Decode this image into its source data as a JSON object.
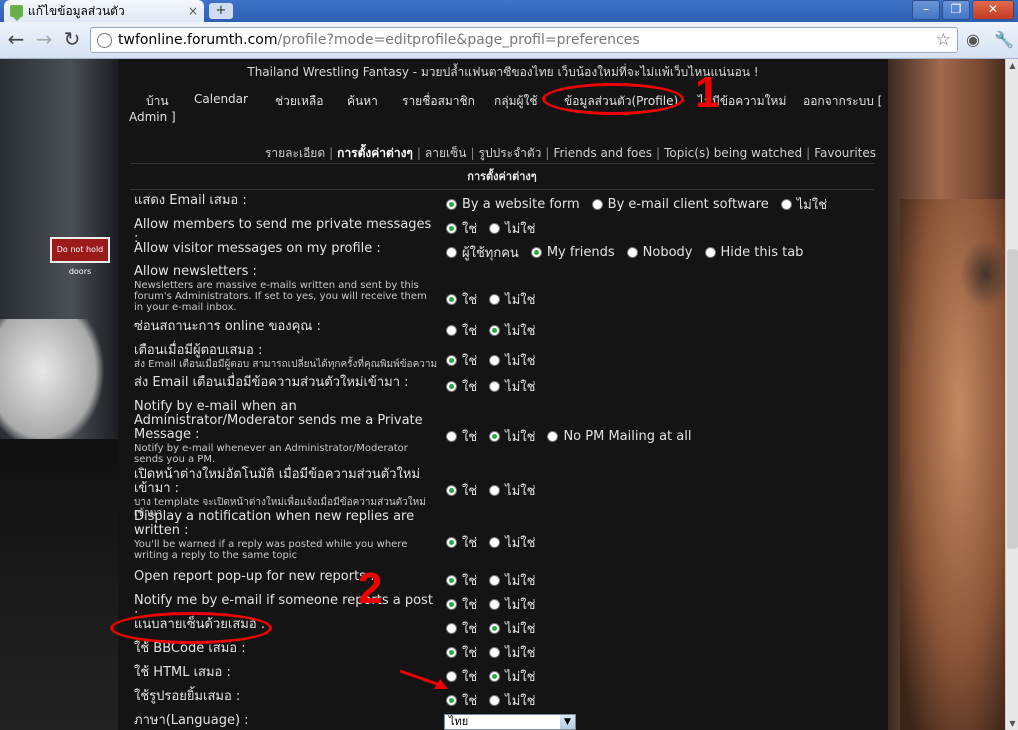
{
  "browser": {
    "tab_title": "แก้ไขข้อมูลส่วนตัว",
    "tab_close": "×",
    "new_tab": "+",
    "window_minimize": "–",
    "window_maximize": "❐",
    "window_close": "✕",
    "back": "←",
    "forward": "→",
    "reload": "↻",
    "url_domain": "twfonline.forumth.com",
    "url_path": "/profile?mode=editprofile&page_profil=preferences",
    "star": "☆"
  },
  "site": {
    "title": "Thailand Wrestling Fantasy - มวยปล้ำแฟนตาซีของไทย เว็บน้องใหม่ที่จะไม่แพ้เว็บไหนแน่นอน !",
    "nav": [
      "บ้าน",
      "Calendar",
      "ช่วยเหลือ",
      "ค้นหา",
      "รายชื่อสมาชิก",
      "กลุ่มผู้ใช้",
      "ข้อมูลส่วนตัว(Profile)",
      "ไม่มีข้อความใหม่",
      "ออกจากระบบ [",
      "Admin ]"
    ],
    "subnav": [
      "รายละเอียด",
      "การตั้งค่าต่างๆ",
      "ลายเซ็น",
      "รูปประจำตัว",
      "Friends and foes",
      "Topic(s) being watched",
      "Favourites"
    ],
    "section_header": "การตั้งค่าต่างๆ",
    "bg_sign": "Do not hold doors"
  },
  "prefs": [
    {
      "label": "แสดง Email เสมอ :",
      "options": [
        "By a website form",
        "By e-mail client software",
        "ไม่ใช่"
      ],
      "selected": 0
    },
    {
      "label": "Allow members to send me private messages :",
      "options": [
        "ใช่",
        "ไม่ใช่"
      ],
      "selected": 0
    },
    {
      "label": "Allow visitor messages on my profile :",
      "options": [
        "ผู้ใช้ทุกคน",
        "My friends",
        "Nobody",
        "Hide this tab"
      ],
      "selected": 1
    },
    {
      "label": "Allow newsletters :",
      "desc": "Newsletters are massive e-mails written and sent by this forum's Administrators. If set to yes, you will receive them in your e-mail inbox.",
      "options": [
        "ใช่",
        "ไม่ใช่"
      ],
      "selected": 0
    },
    {
      "label": "ซ่อนสถานะการ online ของคุณ :",
      "options": [
        "ใช่",
        "ไม่ใช่"
      ],
      "selected": 1
    },
    {
      "label": "เตือนเมื่อมีผู้ตอบเสมอ :",
      "desc": "ส่ง Email เตือนเมื่อมีผู้ตอบ สามารถเปลี่ยนได้ทุกครั้งที่คุณพิมพ์ข้อความ",
      "options": [
        "ใช่",
        "ไม่ใช่"
      ],
      "selected": 0
    },
    {
      "label": "ส่ง Email เตือนเมื่อมีข้อความส่วนตัวใหม่เข้ามา :",
      "options": [
        "ใช่",
        "ไม่ใช่"
      ],
      "selected": 0
    },
    {
      "label": "Notify by e-mail when an Administrator/Moderator sends me a Private Message :",
      "desc": "Notify by e-mail whenever an Administrator/Moderator sends you a PM.",
      "options": [
        "ใช่",
        "ไม่ใช่",
        "No PM Mailing at all"
      ],
      "selected": 1
    },
    {
      "label": "เปิดหน้าต่างใหม่อัตโนมัติ เมื่อมีข้อความส่วนตัวใหม่เข้ามา :",
      "desc": "บาง template จะเปิดหน้าต่างใหม่เพื่อแจ้งเมื่อมีข้อความส่วนตัวใหม่เข้ามา",
      "options": [
        "ใช่",
        "ไม่ใช่"
      ],
      "selected": 0
    },
    {
      "label": "Display a notification when new replies are written :",
      "desc": "You'll be warned if a reply was posted while you where writing a reply to the same topic",
      "options": [
        "ใช่",
        "ไม่ใช่"
      ],
      "selected": 0
    },
    {
      "label": "Open report pop-up for new reports :",
      "options": [
        "ใช่",
        "ไม่ใช่"
      ],
      "selected": 0
    },
    {
      "label": "Notify me by e-mail if someone reports a post :",
      "options": [
        "ใช่",
        "ไม่ใช่"
      ],
      "selected": 0
    },
    {
      "label": "แนบลายเซ็นด้วยเสมอ :",
      "options": [
        "ใช่",
        "ไม่ใช่"
      ],
      "selected": 1
    },
    {
      "label": "ใช้ BBCode เสมอ :",
      "options": [
        "ใช่",
        "ไม่ใช่"
      ],
      "selected": 0
    },
    {
      "label": "ใช้ HTML เสมอ :",
      "options": [
        "ใช่",
        "ไม่ใช่"
      ],
      "selected": 1
    },
    {
      "label": "ใช้รูปรอยยิ้มเสมอ :",
      "options": [
        "ใช่",
        "ไม่ใช่"
      ],
      "selected": 0
    },
    {
      "label": "ภาษา(Language) :",
      "select_value": "ไทย"
    }
  ],
  "annotations": {
    "num1": "1",
    "num2": "2",
    "color": "#e00000"
  },
  "colors": {
    "page_bg": "#141414",
    "radio_selected": "#28a745"
  }
}
